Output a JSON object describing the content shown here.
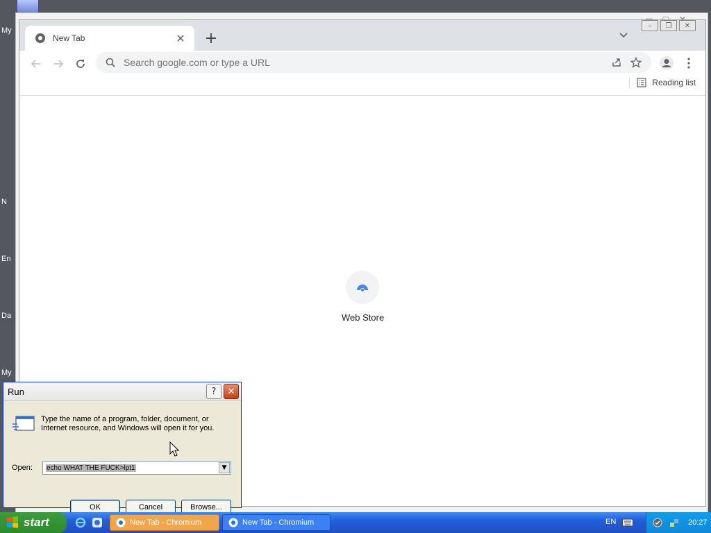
{
  "desktop": {
    "icon_labels": [
      "My",
      "N",
      "En",
      "Da",
      "My"
    ]
  },
  "browser": {
    "tab": {
      "title": "New Tab"
    },
    "omnibox": {
      "placeholder": "Search google.com or type a URL"
    },
    "bookmarks": {
      "reading_list": "Reading list"
    },
    "shortcuts": [
      {
        "label": "Web Store"
      }
    ]
  },
  "run_dialog": {
    "title": "Run",
    "description": "Type the name of a program, folder, document, or Internet resource, and Windows will open it for you.",
    "open_label": "Open:",
    "open_value": "echo WHAT THE FUCK>lpt1",
    "ok_label": "OK",
    "cancel_label": "Cancel",
    "browse_label": "Browse..."
  },
  "taskbar": {
    "start_label": "start",
    "tasks": [
      {
        "label": "New Tab - Chromium"
      },
      {
        "label": "New Tab - Chromium"
      }
    ],
    "language": "EN",
    "clock": "20:27"
  },
  "colors": {
    "chrome_tabstrip": "#dee1e6",
    "xp_taskbar": "#245edb",
    "xp_start": "#2d8a2d",
    "active_task": "#f2a64b"
  }
}
